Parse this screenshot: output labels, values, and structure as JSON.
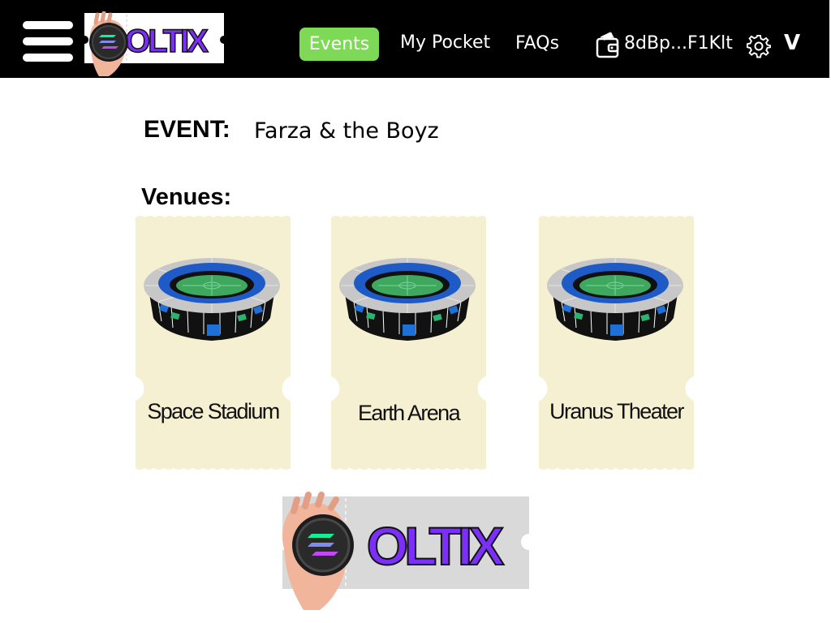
{
  "nav": {
    "events_label": "Events",
    "pocket_label": "My Pocket",
    "faqs_label": "FAQs",
    "wallet_address": "8dBp...F1Klt",
    "chevron_label": "V",
    "icons": [
      "menu-icon",
      "wallet-icon",
      "gear-icon"
    ]
  },
  "brand": {
    "name": "OLTIX"
  },
  "event": {
    "label": "EVENT:",
    "name": "Farza & the Boyz"
  },
  "venues": {
    "label": "Venues:",
    "items": [
      {
        "name": "Space Stadium"
      },
      {
        "name": "Earth Arena"
      },
      {
        "name": "Uranus Theater"
      }
    ]
  },
  "colors": {
    "topbar": "#000000",
    "active_tab": "#7ed957",
    "ticket": "#f6f0d2",
    "brand_purple": "#7b2ff7",
    "logo_ticket_gray": "#d9d9d9"
  }
}
